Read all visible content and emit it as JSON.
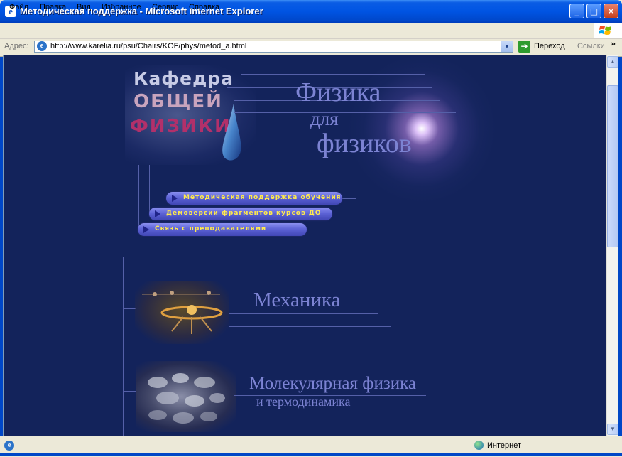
{
  "window": {
    "title": "Методическая поддержка - Microsoft Internet Explorer"
  },
  "menu": [
    "Файл",
    "Правка",
    "Вид",
    "Избранное",
    "Сервис",
    "Справка"
  ],
  "address_bar": {
    "label": "Адрес:",
    "url": "http://www.karelia.ru/psu/Chairs/KOF/phys/metod_a.html",
    "go_label": "Переход",
    "links_label": "Ссылки"
  },
  "page": {
    "logo": {
      "line1": "Кафедра",
      "line2": "ОБЩЕЙ",
      "line3": "ФИЗИКИ"
    },
    "heading": {
      "line1": "Физика",
      "line2": "для",
      "line3": "физиков"
    },
    "nav_buttons": [
      "Методическая поддержка обучения",
      "Демоверсии фрагментов курсов ДО",
      "Связь с преподавателями"
    ],
    "sections": [
      {
        "title": "Механика"
      },
      {
        "title": "Молекулярная физика",
        "subtitle": "и термодинамика"
      }
    ]
  },
  "status_bar": {
    "zone": "Интернет"
  },
  "colors": {
    "page_background": "#13235b",
    "heading": "#7c83d3",
    "button_text": "#ffea4d",
    "titlebar": "#0054e3"
  }
}
